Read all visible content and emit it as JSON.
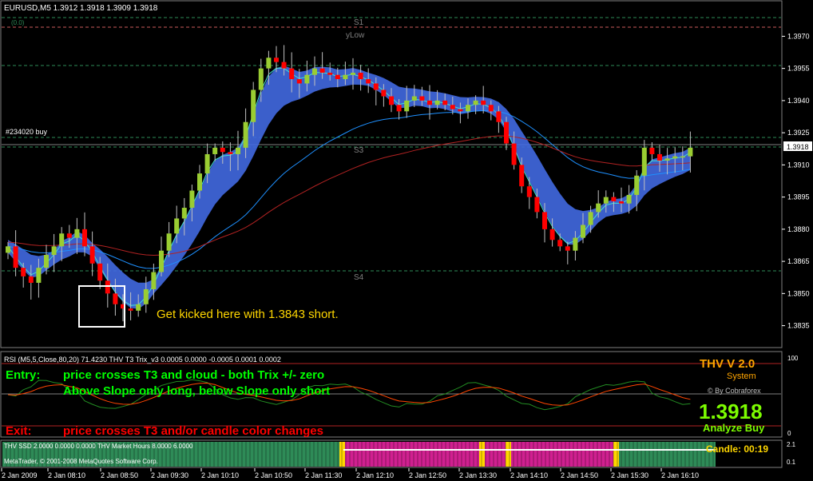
{
  "window": {
    "title": "EURUSD,M5  1.3912 1.3918 1.3909 1.3918",
    "mini_label": "(0.0)"
  },
  "main_chart": {
    "price_labels": [
      "1.3970",
      "1.3955",
      "1.3940",
      "1.3925",
      "1.3910",
      "1.3895",
      "1.3880",
      "1.3865",
      "1.3850",
      "1.3835"
    ],
    "current_price": "1.3918",
    "levels": {
      "s1": "S1",
      "ylow": "yLow",
      "s3": "S3",
      "s4": "S4"
    },
    "order_label": "#234020 buy",
    "annotation": "Get kicked here with 1.3843 short."
  },
  "rsi_panel": {
    "header": "RSI (M5,5,Close,80,20) 71.4230     THV T3 Trix_v3  0.0005 0.0000 -0.0005 0.0001 0.0002",
    "scale_top": "100",
    "scale_bottom": "0",
    "system_title": "THV V 2.0",
    "system_sub": "System",
    "credit": "© By Cobraforex",
    "big_price": "1.3918",
    "signal": "Analyze Buy",
    "entry_label": "Entry:",
    "entry_line1": "price crosses T3 and cloud - both Trix +/- zero",
    "entry_line2": "Above Slope only long, below Slope only short",
    "exit_label": "Exit:",
    "exit_line": "price crosses T3 and/or candle color changes"
  },
  "ssd_panel": {
    "header": "THV SSD 2.0000 0.0000 0.0000  THV Market Hours 8.0000 6.0000",
    "footer": "MetaTrader, © 2001-2008 MetaQuotes Software Corp.",
    "candle_label": "Candle:  00:19",
    "scale_top": "2.1",
    "scale_bottom": "0.1"
  },
  "time_axis": [
    "2 Jan 2009",
    "2 Jan 08:10",
    "2 Jan 08:50",
    "2 Jan 09:30",
    "2 Jan 10:10",
    "2 Jan 10:50",
    "2 Jan 11:30",
    "2 Jan 12:10",
    "2 Jan 12:50",
    "2 Jan 13:30",
    "2 Jan 14:10",
    "2 Jan 14:50",
    "2 Jan 15:30",
    "2 Jan 16:10"
  ],
  "colors": {
    "bull_candle": "#9acd32",
    "bear_candle": "#ff0000",
    "cloud": "#4169e1",
    "t3_line": "#40e0d0",
    "slope_line": "#1e90ff",
    "ma_line": "#b22222",
    "entry_text": "#00ff00",
    "exit_text": "#ff0000",
    "annotation_text": "#ffd700",
    "system_title": "#ffa500",
    "big_price": "#7cfc00"
  },
  "chart_data": {
    "type": "candlestick",
    "symbol": "EURUSD",
    "timeframe": "M5",
    "ylim": [
      1.383,
      1.3975
    ],
    "levels": [
      {
        "name": "S1",
        "value": 1.397
      },
      {
        "name": "S3",
        "value": 1.3918
      },
      {
        "name": "S4",
        "value": 1.3865
      }
    ],
    "closes": [
      1.3872,
      1.3862,
      1.3858,
      1.3855,
      1.3862,
      1.3868,
      1.3872,
      1.3878,
      1.3876,
      1.388,
      1.3872,
      1.3864,
      1.3856,
      1.385,
      1.3845,
      1.3843,
      1.3842,
      1.3845,
      1.3852,
      1.386,
      1.387,
      1.3878,
      1.3885,
      1.389,
      1.3898,
      1.3906,
      1.3915,
      1.3918,
      1.3916,
      1.3915,
      1.3918,
      1.393,
      1.3945,
      1.3955,
      1.396,
      1.3958,
      1.3955,
      1.395,
      1.3948,
      1.3952,
      1.3955,
      1.3953,
      1.3952,
      1.395,
      1.3952,
      1.3953,
      1.395,
      1.3948,
      1.3945,
      1.3942,
      1.3938,
      1.3935,
      1.394,
      1.3942,
      1.394,
      1.3938,
      1.394,
      1.3938,
      1.3936,
      1.3935,
      1.3938,
      1.394,
      1.3938,
      1.3935,
      1.393,
      1.392,
      1.391,
      1.39,
      1.3895,
      1.3888,
      1.388,
      1.3875,
      1.3872,
      1.387,
      1.3876,
      1.3882,
      1.3888,
      1.3892,
      1.3895,
      1.3893,
      1.3892,
      1.3896,
      1.3905,
      1.3918,
      1.3915,
      1.3912,
      1.3913,
      1.3914,
      1.3914,
      1.3918
    ]
  }
}
